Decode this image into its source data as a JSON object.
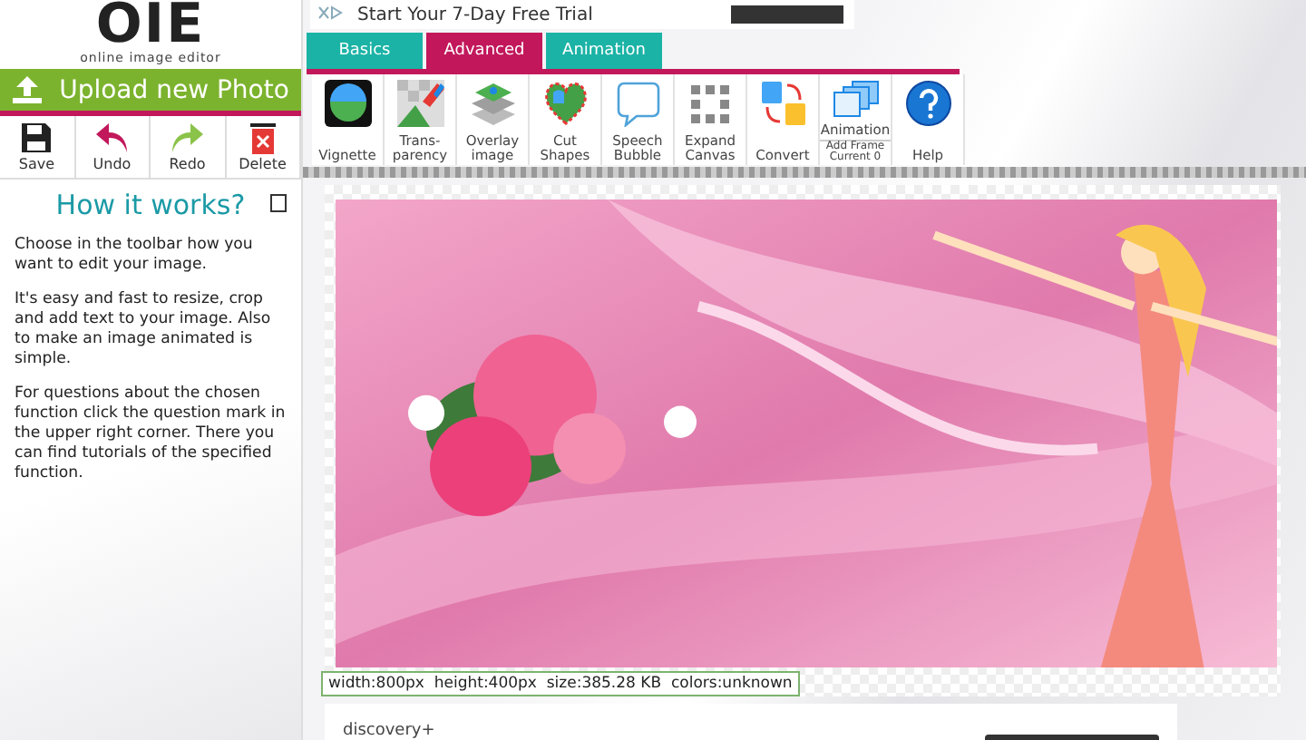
{
  "sidebar": {
    "logo": {
      "letters": "OIE",
      "tagline": "online image editor"
    },
    "upload_button": "Upload new Photo",
    "actions": [
      {
        "kind": "save",
        "label": "Save"
      },
      {
        "kind": "undo",
        "label": "Undo"
      },
      {
        "kind": "redo",
        "label": "Redo"
      },
      {
        "kind": "delete",
        "label": "Delete"
      }
    ],
    "heading": "How it works?",
    "paragraphs": [
      "Choose in the toolbar how you want to edit your image.",
      "It's easy and fast to resize, crop and add text to your image. Also to make an image animated is simple.",
      "For questions about the chosen function click the question mark in the upper right corner. There you can find tutorials of the specified function."
    ]
  },
  "ad_top": {
    "text": "Start Your 7-Day Free Trial"
  },
  "tabs": [
    {
      "label": "Basics",
      "selected": false
    },
    {
      "label": "Advanced",
      "selected": true
    },
    {
      "label": "Animation",
      "selected": false
    }
  ],
  "tools": [
    {
      "kind": "vignette",
      "label": "Vignette"
    },
    {
      "kind": "transparency",
      "label": "Trans-\nparency"
    },
    {
      "kind": "overlay",
      "label": "Overlay\nimage"
    },
    {
      "kind": "cut",
      "label": "Cut\nShapes"
    },
    {
      "kind": "bubble",
      "label": "Speech\nBubble"
    },
    {
      "kind": "expand",
      "label": "Expand\nCanvas"
    },
    {
      "kind": "convert",
      "label": "Convert"
    },
    {
      "kind": "animation",
      "label": "Animation",
      "sub": "Add Frame\nCurrent 0"
    },
    {
      "kind": "help",
      "label": "Help"
    }
  ],
  "canvas": {
    "info": "width:800px  height:400px  size:385.28 KB  colors:unknown"
  },
  "ad_bottom": {
    "text": "discovery+"
  }
}
